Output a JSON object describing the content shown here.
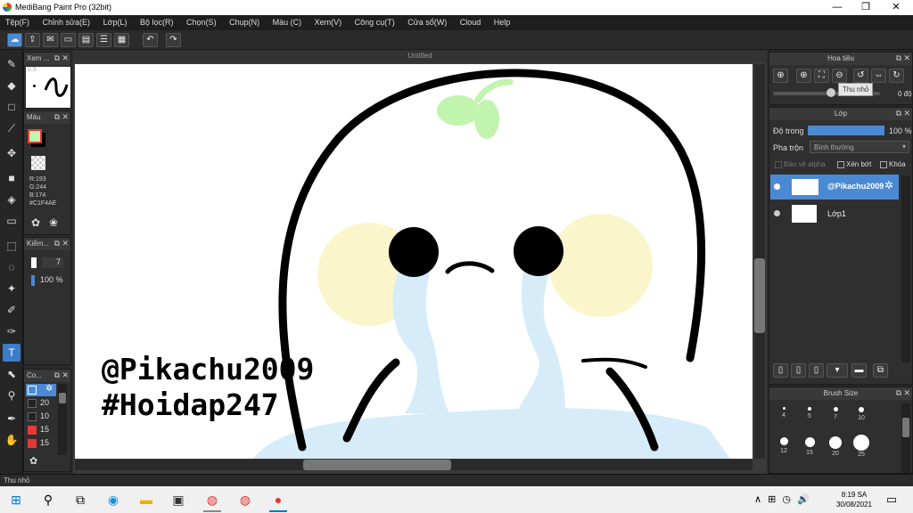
{
  "app": {
    "title": "MediBang Paint Pro (32bit)"
  },
  "window_controls": {
    "minimize": "—",
    "maximize": "❐",
    "close": "✕"
  },
  "menu": [
    "Tệp(F)",
    "Chỉnh sửa(E)",
    "Lớp(L)",
    "Bộ lọc(R)",
    "Chọn(S)",
    "Chụp(N)",
    "Màu (C)",
    "Xem(V)",
    "Công cụ(T)",
    "Cửa sổ(W)",
    "Cloud",
    "Help"
  ],
  "document": {
    "tab_title": "Untitled"
  },
  "canvas": {
    "text_line1": "@Pikachu2009",
    "text_line2": "#Hoidap247"
  },
  "left_panels": {
    "brush_preview": {
      "title": "Xem ...",
      "size": "0.5"
    },
    "color": {
      "title": "Màu",
      "foreground": "#C1F4AE",
      "r": "R:193",
      "g": "G:244",
      "b": "B:174",
      "hex": "#C1F4AE"
    },
    "brush_control": {
      "title": "Kiểm...",
      "size": "7",
      "opacity": "100 %"
    },
    "color_list": {
      "title": "Co...",
      "items": [
        {
          "value": "20",
          "color": "#222222"
        },
        {
          "value": "10",
          "color": "#222222"
        },
        {
          "value": "15",
          "color": "#e53935"
        },
        {
          "value": "15",
          "color": "#e53935"
        }
      ]
    }
  },
  "navigator": {
    "title": "Hoa tiêu",
    "tooltip": "Thu nhỏ",
    "rotation": "0 độ"
  },
  "layer_panel": {
    "title": "Lớp",
    "opacity_label": "Độ trong",
    "opacity_value": "100 %",
    "blend_label": "Pha trộn",
    "blend_value": "Bình thường",
    "protect_alpha": "Bảo vệ alpha",
    "clipping": "Xén bớt",
    "lock": "Khóa",
    "layers": [
      {
        "name": "@Pikachu2009",
        "selected": true
      },
      {
        "name": "Lớp1",
        "selected": false
      }
    ]
  },
  "brush_size": {
    "title": "Brush Size",
    "sizes": [
      "4",
      "5",
      "7",
      "10",
      "12",
      "15",
      "20",
      "25"
    ]
  },
  "status": {
    "text": "Thu nhỏ"
  },
  "taskbar": {
    "time": "8:19 SA",
    "date": "30/08/2021",
    "tray": "∧ ⊞ ◷ 🔊"
  },
  "colors": {
    "accent": "#4a8ad4",
    "leaf": "#c1f4ae",
    "tears": "#d6ecf8",
    "cheeks": "#fbf5cc"
  }
}
